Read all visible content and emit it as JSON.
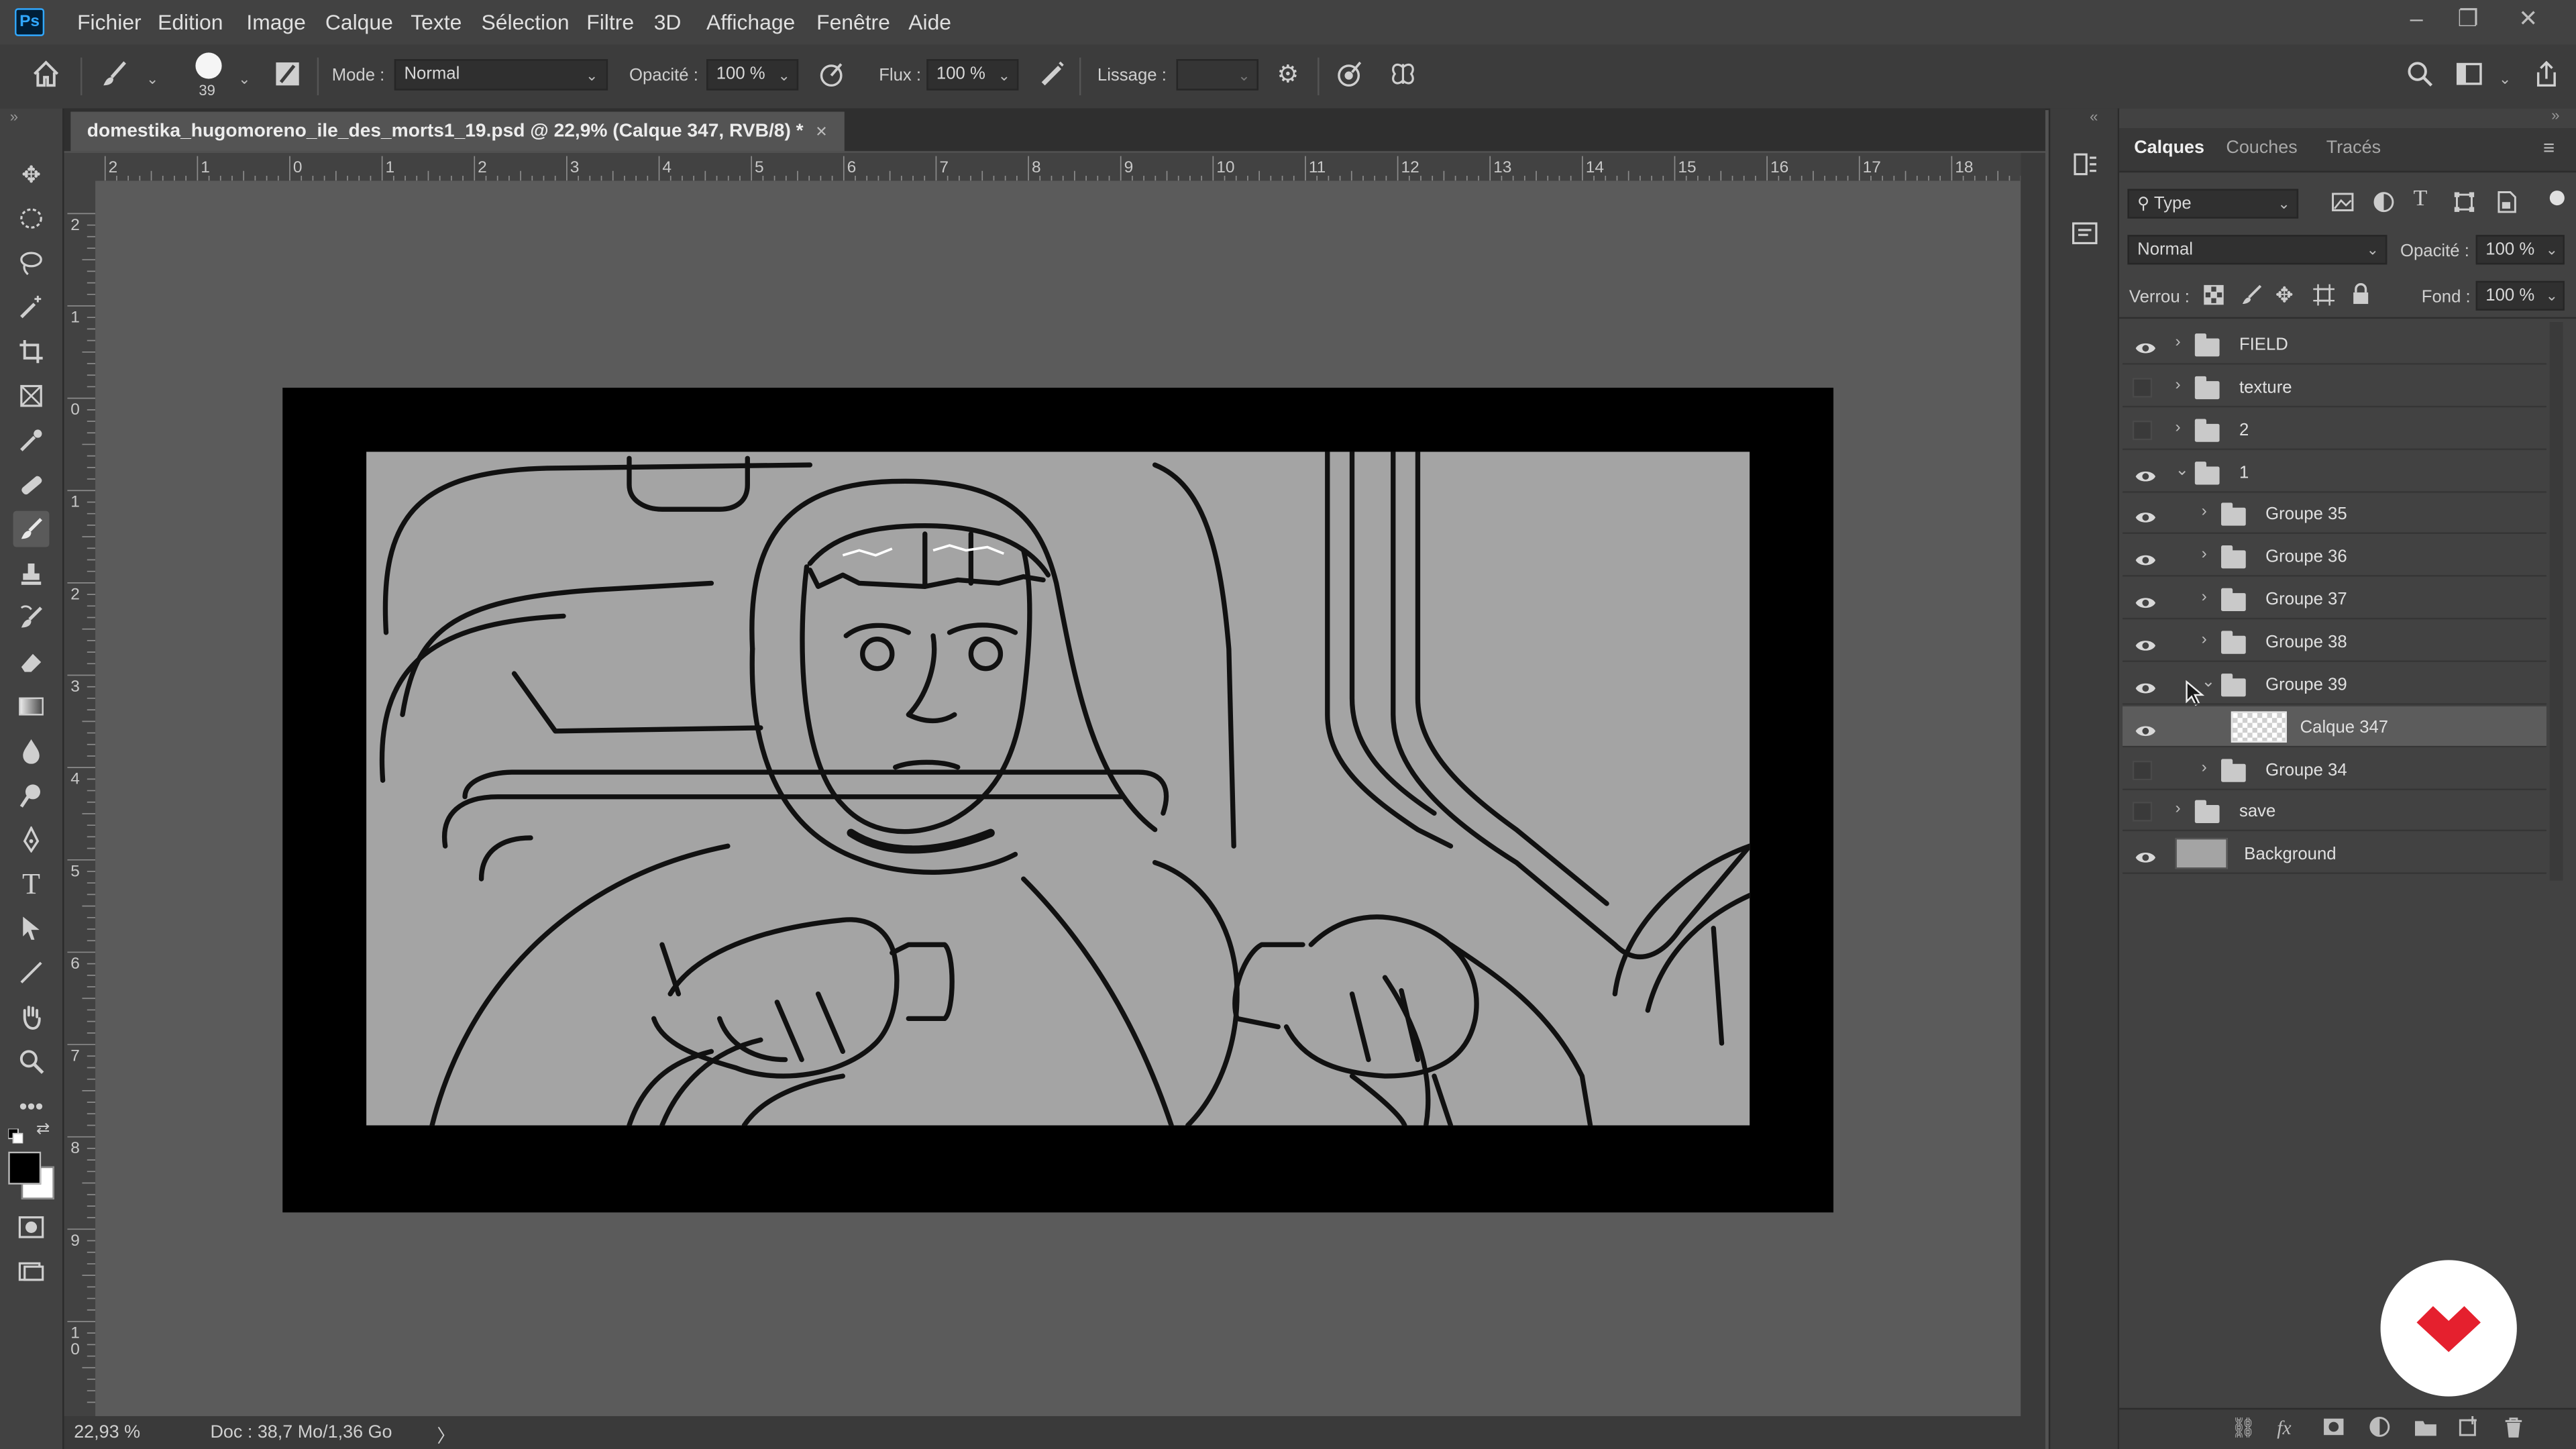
{
  "app": {
    "logo": "Ps"
  },
  "menu": [
    "Fichier",
    "Edition",
    "Image",
    "Calque",
    "Texte",
    "Sélection",
    "Filtre",
    "3D",
    "Affichage",
    "Fenêtre",
    "Aide"
  ],
  "window_controls": [
    "–",
    "❐",
    "✕"
  ],
  "options": {
    "brush_size": "39",
    "mode_label": "Mode :",
    "mode_value": "Normal",
    "opacity_label": "Opacité :",
    "opacity_value": "100 %",
    "flow_label": "Flux :",
    "flow_value": "100 %",
    "smoothing_label": "Lissage :",
    "smoothing_value": ""
  },
  "document": {
    "tab_title": "domestika_hugomoreno_ile_des_morts1_19.psd @ 22,9% (Calque 347, RVB/8) *",
    "close": "✕",
    "zoom": "22,93 %",
    "doc_info": "Doc : 38,7 Mo/1,36 Go",
    "status_arrow": "〉"
  },
  "rulers": {
    "h_ticks": [
      "2",
      "1",
      "0",
      "1",
      "2",
      "3",
      "4",
      "5",
      "6",
      "7",
      "8",
      "9",
      "10",
      "11",
      "12",
      "13",
      "14",
      "15",
      "16",
      "17",
      "18"
    ],
    "v_ticks": [
      "2",
      "1",
      "0",
      "1",
      "2",
      "3",
      "4",
      "5",
      "6",
      "7",
      "8",
      "9",
      "1\n0"
    ]
  },
  "layers_panel": {
    "tabs": [
      "Calques",
      "Couches",
      "Tracés"
    ],
    "filter_value": "Type",
    "blend_value": "Normal",
    "opacity_label": "Opacité :",
    "opacity_value": "100 %",
    "lock_label": "Verrou :",
    "fill_label": "Fond :",
    "fill_value": "100 %",
    "layers": [
      {
        "name": "FIELD",
        "visible": true,
        "type": "group",
        "indent": 0,
        "expanded": false,
        "selected": false
      },
      {
        "name": "texture",
        "visible": false,
        "type": "group",
        "indent": 0,
        "expanded": false,
        "selected": false
      },
      {
        "name": "2",
        "visible": false,
        "type": "group",
        "indent": 0,
        "expanded": false,
        "selected": false
      },
      {
        "name": "1",
        "visible": true,
        "type": "group",
        "indent": 0,
        "expanded": true,
        "selected": false
      },
      {
        "name": "Groupe 35",
        "visible": true,
        "type": "group",
        "indent": 1,
        "expanded": false,
        "selected": false
      },
      {
        "name": "Groupe 36",
        "visible": true,
        "type": "group",
        "indent": 1,
        "expanded": false,
        "selected": false
      },
      {
        "name": "Groupe 37",
        "visible": true,
        "type": "group",
        "indent": 1,
        "expanded": false,
        "selected": false
      },
      {
        "name": "Groupe 38",
        "visible": true,
        "type": "group",
        "indent": 1,
        "expanded": false,
        "selected": false
      },
      {
        "name": "Groupe 39",
        "visible": true,
        "type": "group",
        "indent": 1,
        "expanded": true,
        "selected": false
      },
      {
        "name": "Calque 347",
        "visible": true,
        "type": "layer",
        "indent": 2,
        "expanded": false,
        "selected": true
      },
      {
        "name": "Groupe 34",
        "visible": false,
        "type": "group",
        "indent": 1,
        "expanded": false,
        "selected": false
      },
      {
        "name": "save",
        "visible": false,
        "type": "group",
        "indent": 0,
        "expanded": false,
        "selected": false
      },
      {
        "name": "Background",
        "visible": true,
        "type": "background",
        "indent": 0,
        "expanded": false,
        "selected": false
      }
    ]
  },
  "colors": {
    "accent": "#31a8ff",
    "domestika_red": "#e5202e",
    "canvas_gray": "#a4a4a4"
  }
}
